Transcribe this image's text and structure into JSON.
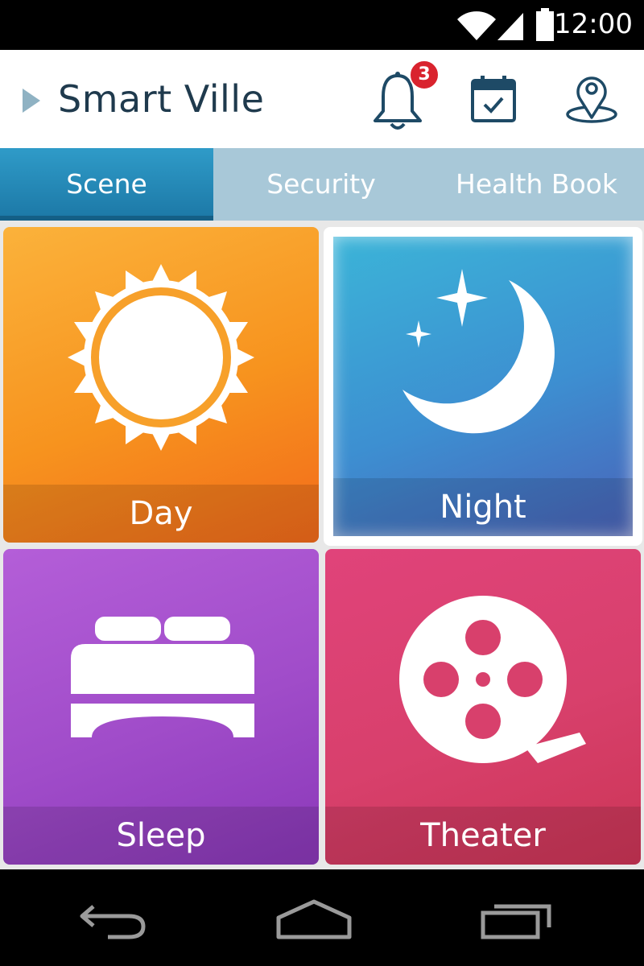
{
  "status_bar": {
    "time": "12:00"
  },
  "app_bar": {
    "title": "Smart Ville",
    "notifications_count": "3",
    "icons": [
      "menu-arrow-icon",
      "bell-icon",
      "calendar-check-icon",
      "location-pin-icon"
    ]
  },
  "tabs": [
    {
      "label": "Scene",
      "active": true
    },
    {
      "label": "Security",
      "active": false
    },
    {
      "label": "Health Book",
      "active": false
    }
  ],
  "scenes": [
    {
      "label": "Day",
      "icon": "sun-icon",
      "color": "#f7931e"
    },
    {
      "label": "Night",
      "icon": "moon-stars-icon",
      "color": "#3d8fd1",
      "selected": true
    },
    {
      "label": "Sleep",
      "icon": "bed-icon",
      "color": "#a04cc9"
    },
    {
      "label": "Theater",
      "icon": "film-reel-icon",
      "color": "#d8406c"
    }
  ],
  "nav_bar": {
    "icons": [
      "back-icon",
      "home-icon",
      "recent-apps-icon"
    ]
  }
}
